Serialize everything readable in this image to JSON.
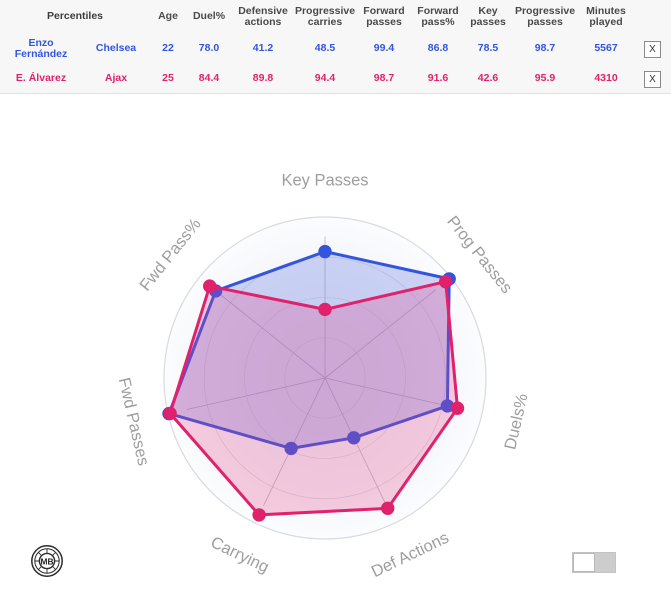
{
  "table": {
    "title": "Percentiles",
    "columns": [
      "Age",
      "Duel%",
      "Defensive actions",
      "Progressive carries",
      "Forward passes",
      "Forward pass%",
      "Key passes",
      "Progressive passes",
      "Minutes played"
    ],
    "columns_split": [
      {
        "l1": "Age",
        "l2": ""
      },
      {
        "l1": "Duel%",
        "l2": ""
      },
      {
        "l1": "Defensive",
        "l2": "actions"
      },
      {
        "l1": "Progressive",
        "l2": "carries"
      },
      {
        "l1": "Forward",
        "l2": "passes"
      },
      {
        "l1": "Forward",
        "l2": "pass%"
      },
      {
        "l1": "Key",
        "l2": "passes"
      },
      {
        "l1": "Progressive",
        "l2": "passes"
      },
      {
        "l1": "Minutes",
        "l2": "played"
      }
    ],
    "remove_label": "X",
    "rows": [
      {
        "name_l1": "Enzo",
        "name_l2": "Fernández",
        "name": "Enzo Fernández",
        "team": "Chelsea",
        "color": "#3355dd",
        "age": "22",
        "duel_pct": "78.0",
        "def_actions": "41.2",
        "prog_carries": "48.5",
        "fwd_passes": "99.4",
        "fwd_pass_pct": "86.8",
        "key_passes": "78.5",
        "prog_passes": "98.7",
        "minutes": "5567"
      },
      {
        "name_l1": "E. Álvarez",
        "name_l2": "",
        "name": "E. Álvarez",
        "team": "Ajax",
        "color": "#e0216b",
        "age": "25",
        "duel_pct": "84.4",
        "def_actions": "89.8",
        "prog_carries": "94.4",
        "fwd_passes": "98.7",
        "fwd_pass_pct": "91.6",
        "key_passes": "42.6",
        "prog_passes": "95.9",
        "minutes": "4310"
      }
    ]
  },
  "chart_data": {
    "type": "radar",
    "title": "",
    "axis_labels": [
      "Key Passes",
      "Prog Passes",
      "Duels%",
      "Def Actions",
      "Carrying",
      "Fwd Passes",
      "Fwd Pass%"
    ],
    "scale_min": 0,
    "scale_max": 100,
    "rings": [
      25,
      50,
      75,
      100
    ],
    "grid": true,
    "legend_position": "table-above",
    "series": [
      {
        "name": "Enzo Fernández",
        "color": "#3355dd",
        "fill": "rgba(90,110,225,0.28)",
        "values": [
          78.5,
          98.7,
          78.0,
          41.2,
          48.5,
          99.4,
          86.8
        ]
      },
      {
        "name": "E. Álvarez",
        "color": "#e0216b",
        "fill": "rgba(230,60,130,0.25)",
        "values": [
          42.6,
          95.9,
          84.4,
          89.8,
          94.4,
          98.7,
          91.6
        ]
      }
    ]
  },
  "footer": {
    "logo_text": "MB",
    "logo_name": "football-logo",
    "toggle_state": "off"
  }
}
